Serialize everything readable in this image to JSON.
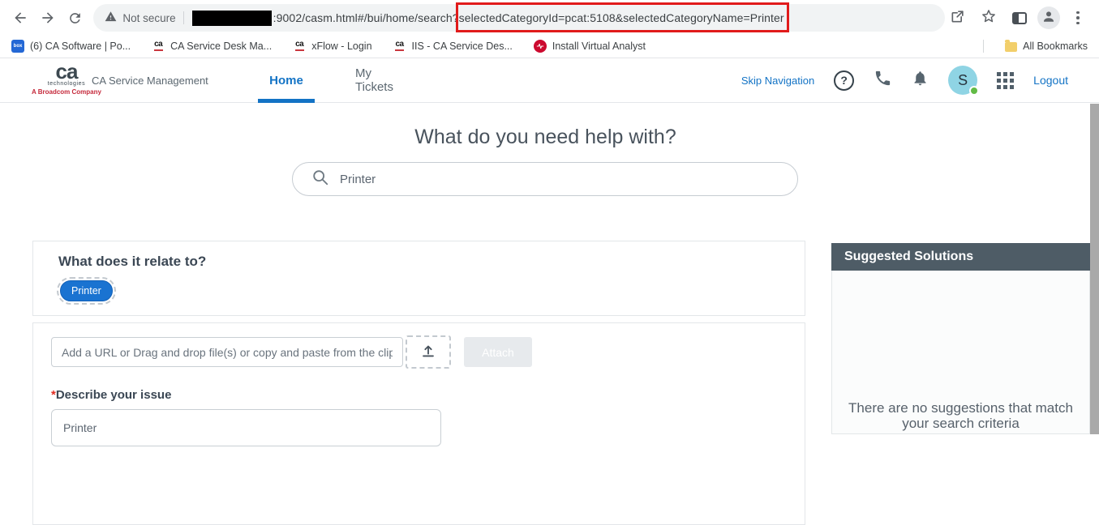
{
  "colors": {
    "accent_blue": "#1373c5",
    "highlight_red": "#e11b1b",
    "panel_slate": "#4e5c66",
    "pill_blue": "#1a73d1",
    "avatar_blue": "#8fd4e4",
    "status_green": "#62bb46",
    "ca_red": "#c5293b"
  },
  "browser": {
    "address_bar": {
      "security_label": "Not secure",
      "url_prefix": ":9002/casm.html#/bui/home/search?",
      "url_highlighted": "selectedCategoryId=pcat:5108&selectedCategoryName=Printer"
    },
    "bookmarks": [
      {
        "icon": "box-icon",
        "glyph": "box",
        "label": "(6) CA Software | Po..."
      },
      {
        "icon": "ca-icon",
        "glyph": "ca",
        "label": "CA Service Desk Ma..."
      },
      {
        "icon": "ca-icon",
        "glyph": "ca",
        "label": "xFlow - Login"
      },
      {
        "icon": "ca-icon",
        "glyph": "ca",
        "label": "IIS - CA Service Des..."
      },
      {
        "icon": "broadcom-icon",
        "label": "Install Virtual Analyst"
      }
    ],
    "all_bookmarks_label": "All Bookmarks"
  },
  "app_header": {
    "logo": {
      "mark": "ca",
      "sub": "technologies",
      "tagline": "A Broadcom Company"
    },
    "product_name": "CA Service Management",
    "tabs": [
      {
        "label": "Home",
        "active": true
      },
      {
        "label": "My Tickets",
        "active": false
      }
    ],
    "skip_navigation": "Skip Navigation",
    "help_glyph": "?",
    "avatar_initial": "S",
    "logout": "Logout"
  },
  "main": {
    "heading": "What do you need help with?",
    "search_value": "Printer",
    "relate_card": {
      "heading": "What does it relate to?",
      "pill": "Printer"
    },
    "attach_card": {
      "placeholder": "Add a URL or Drag and drop file(s) or copy and paste from the clipbo",
      "attach_button": "Attach",
      "required_mark": "*",
      "describe_label": "Describe your issue",
      "describe_value": "Printer"
    },
    "suggested_panel": {
      "title": "Suggested Solutions",
      "empty_message": "There are no suggestions that match your search criteria"
    }
  }
}
